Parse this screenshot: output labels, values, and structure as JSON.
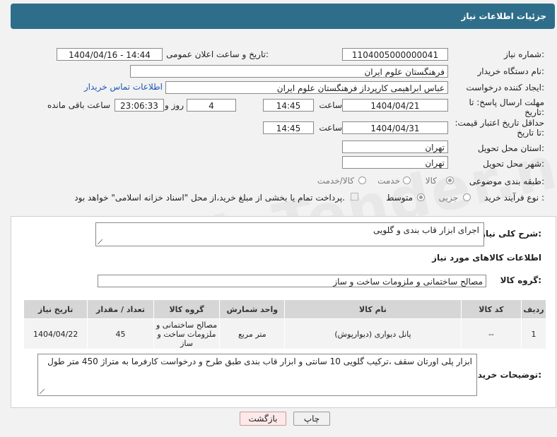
{
  "title": "جزئیات اطلاعات نیاز",
  "watermark": "AriaTender.neT",
  "fields": {
    "need_number_label": "شماره نیاز:",
    "need_number": "1104005000000041",
    "announce_label": "تاریخ و ساعت اعلان عمومی:",
    "announce_value": "1404/04/16 - 14:44",
    "buyer_org_label": "نام دستگاه خریدار:",
    "buyer_org": "فرهنگستان علوم ایران",
    "requester_label": "ایجاد کننده درخواست:",
    "requester": "عباس ابراهیمی کارپرداز فرهنگستان علوم ایران",
    "contact_link": "اطلاعات تماس خریدار",
    "reply_deadline_label": "مهلت ارسال پاسخ: تا تاریخ:",
    "reply_date": "1404/04/21",
    "time_label": "ساعت",
    "reply_time": "14:45",
    "days_value": "4",
    "days_label": "روز و",
    "remaining_value": "23:06:33",
    "remaining_label": "ساعت باقی مانده",
    "price_validity_label": "حداقل تاریخ اعتبار قیمت: تا تاریخ:",
    "price_date": "1404/04/31",
    "price_time": "14:45",
    "province_label": "استان محل تحویل:",
    "province": "تهران",
    "city_label": "شهر محل تحویل:",
    "city": "تهران",
    "category_label": "طبقه بندی موضوعی:",
    "category_options": [
      "کالا",
      "خدمت",
      "کالا/خدمت"
    ],
    "process_label": "نوع فرآیند خرید :",
    "process_options": [
      "جزیی",
      "متوسط"
    ],
    "payment_note": "پرداخت تمام یا بخشی از مبلغ خرید،از محل \"اسناد خزانه اسلامی\" خواهد بود."
  },
  "description": {
    "label": "شرح کلی نیاز:",
    "value": "اجرای ابزار قاب بندی و گلویی"
  },
  "goods_info_title": "اطلاعات کالاهای مورد نیاز",
  "goods_group": {
    "label": "گروه کالا:",
    "value": "مصالح ساختمانی و ملزومات ساخت و ساز"
  },
  "table": {
    "headers": [
      "ردیف",
      "کد کالا",
      "نام کالا",
      "واحد شمارش",
      "گروه کالا",
      "تعداد / مقدار",
      "تاریخ نیاز"
    ],
    "rows": [
      [
        "1",
        "--",
        "پانل دیواری (دیوارپوش)",
        "متر مربع",
        "مصالح ساختمانی و ملزومات ساخت و ساز",
        "45",
        "1404/04/22"
      ]
    ]
  },
  "buyer_notes": {
    "label": "توضیحات خریدار:",
    "value": "ابزار پلی اورتان سقف ،ترکیب گلویی 10 سانتی و ابزار قاب بندی طبق طرح و درخواست کارفرما به متراژ 450 متر طول"
  },
  "buttons": {
    "print": "چاپ",
    "back": "بازگشت"
  }
}
